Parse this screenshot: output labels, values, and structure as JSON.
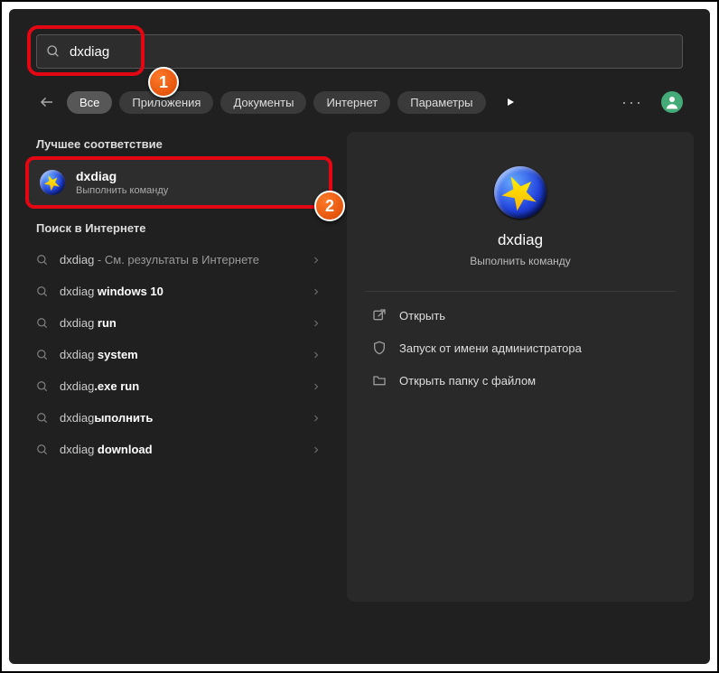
{
  "search": {
    "value": "dxdiag"
  },
  "filters": {
    "items": [
      "Все",
      "Приложения",
      "Документы",
      "Интернет",
      "Параметры"
    ],
    "active_index": 0
  },
  "best_match": {
    "section_label": "Лучшее соответствие",
    "title": "dxdiag",
    "subtitle": "Выполнить команду"
  },
  "web_search": {
    "section_label": "Поиск в Интернете",
    "items": [
      {
        "prefix": "dxdiag",
        "suffix": "",
        "rest": " - См. результаты в Интернете"
      },
      {
        "prefix": "dxdiag ",
        "suffix": "windows 10",
        "rest": ""
      },
      {
        "prefix": "dxdiag ",
        "suffix": "run",
        "rest": ""
      },
      {
        "prefix": "dxdiag ",
        "suffix": "system",
        "rest": ""
      },
      {
        "prefix": "dxdiag",
        "suffix": ".exe run",
        "rest": ""
      },
      {
        "prefix": "dxdiag",
        "suffix": "ыполнить",
        "rest": ""
      },
      {
        "prefix": "dxdiag ",
        "suffix": "download",
        "rest": ""
      }
    ]
  },
  "detail": {
    "title": "dxdiag",
    "subtitle": "Выполнить команду",
    "actions": [
      {
        "icon": "open",
        "label": "Открыть"
      },
      {
        "icon": "admin",
        "label": "Запуск от имени администратора"
      },
      {
        "icon": "folder",
        "label": "Открыть папку с файлом"
      }
    ]
  },
  "annotations": {
    "badge1": "1",
    "badge2": "2"
  }
}
